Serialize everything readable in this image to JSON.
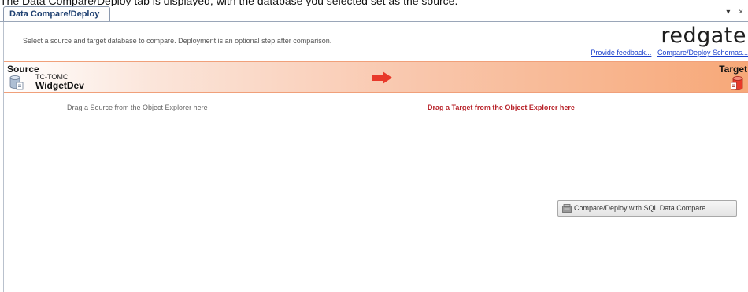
{
  "caption": "The Data Compare/Deploy tab is displayed, with the database you selected set as the source.",
  "tab": {
    "label": "Data Compare/Deploy",
    "controls": "▾ ×"
  },
  "header": {
    "hint": "Select a source and target database to compare. Deployment is an optional step after comparison.",
    "logo": "redgate",
    "feedback_link": "Provide feedback...",
    "schemas_link": "Compare/Deploy Schemas..."
  },
  "source": {
    "label": "Source",
    "server": "TC-TOMC",
    "database": "WidgetDev",
    "drag_hint": "Drag a Source from the Object Explorer here"
  },
  "target": {
    "label": "Target",
    "drag_hint": "Drag a Target from the Object Explorer here"
  },
  "actions": {
    "sdc_button": "Compare/Deploy with SQL Data Compare..."
  },
  "colors": {
    "accent_red": "#e8392a",
    "target_text": "#b8232a",
    "link": "#1a3fcc",
    "band_end": "#f7a878"
  },
  "icons": {
    "source_db": "database-icon",
    "target_db": "database-red-icon",
    "arrow": "right-arrow-icon",
    "button": "database-compare-icon"
  }
}
